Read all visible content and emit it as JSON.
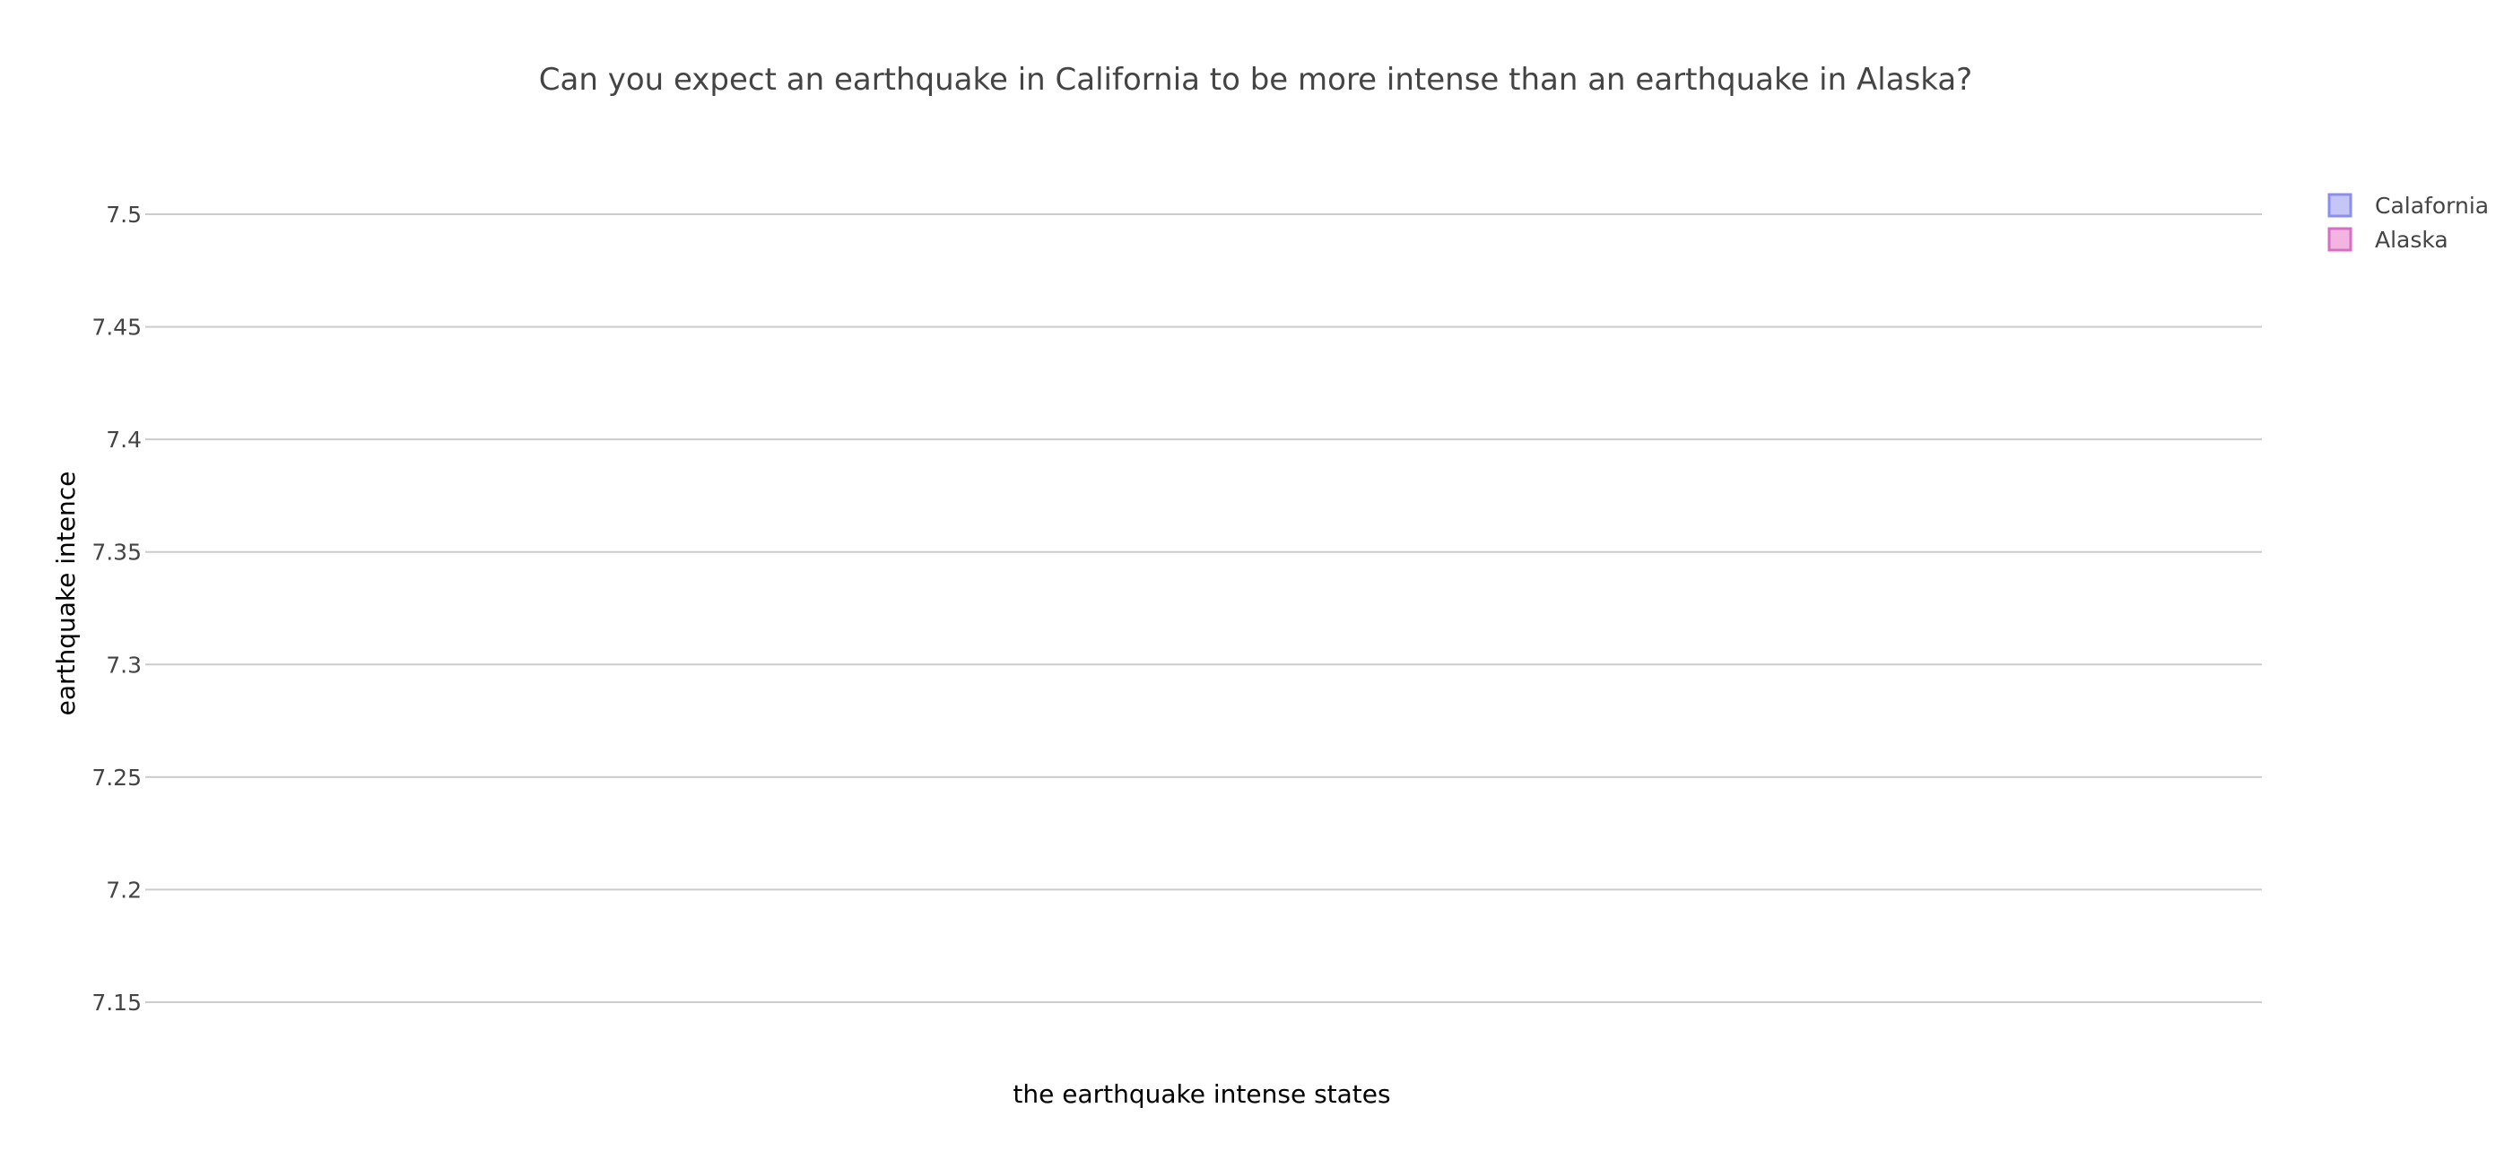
{
  "chart_data": {
    "type": "box",
    "title": "Can you expect an earthquake in California to be more intense than an earthquake in Alaska?",
    "xlabel": "the earthquake intense states",
    "ylabel": "earthquake intence",
    "ylim": [
      7.125,
      7.525
    ],
    "yticks": [
      7.15,
      7.2,
      7.25,
      7.3,
      7.35,
      7.4,
      7.45,
      7.5
    ],
    "ytick_labels": [
      "7.15",
      "7.2",
      "7.25",
      "7.3",
      "7.35",
      "7.4",
      "7.45",
      "7.5"
    ],
    "grid": true,
    "legend_position": "top-right",
    "series": [
      {
        "name": "Calafornia",
        "values": [],
        "fill": "#c5c6f5",
        "stroke": "#8b8ef0"
      },
      {
        "name": "Alaska",
        "values": [],
        "fill": "#f3b4e1",
        "stroke": "#d46fc3"
      }
    ]
  }
}
